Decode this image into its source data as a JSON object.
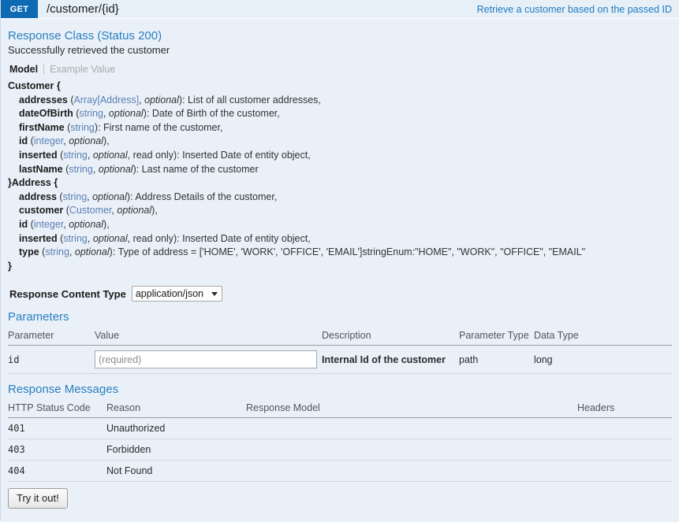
{
  "operation": {
    "method": "GET",
    "path": "/customer/{id}",
    "summary": "Retrieve a customer based on the passed ID"
  },
  "response_class": {
    "title": "Response Class (Status 200)",
    "description": "Successfully retrieved the customer",
    "tabs": {
      "model": "Model",
      "example_value": "Example Value"
    }
  },
  "model": {
    "customer_open": "Customer {",
    "customer_props": [
      {
        "name": "addresses",
        "types": "(Array[Address], optional)",
        "type_text": "Array[Address]",
        "optional": "optional",
        "description": ": List of all customer addresses,"
      },
      {
        "name": "dateOfBirth",
        "type_text": "string",
        "optional": "optional",
        "description": ": Date of Birth of the customer,"
      },
      {
        "name": "firstName",
        "type_text": "string",
        "optional": "",
        "description": ": First name of the customer,"
      },
      {
        "name": "id",
        "type_text": "integer",
        "optional": "optional",
        "description": ","
      },
      {
        "name": "inserted",
        "type_text": "string",
        "optional": "optional",
        "readonly": "read only",
        "description": ": Inserted Date of entity object,"
      },
      {
        "name": "lastName",
        "type_text": "string",
        "optional": "optional",
        "description": ": Last name of the customer"
      }
    ],
    "address_open": "}Address {",
    "address_props": [
      {
        "name": "address",
        "type_text": "string",
        "optional": "optional",
        "description": ": Address Details of the customer,"
      },
      {
        "name": "customer",
        "type_text": "Customer",
        "optional": "optional",
        "description": ","
      },
      {
        "name": "id",
        "type_text": "integer",
        "optional": "optional",
        "description": ","
      },
      {
        "name": "inserted",
        "type_text": "string",
        "optional": "optional",
        "readonly": "read only",
        "description": ": Inserted Date of entity object,"
      },
      {
        "name": "type",
        "type_text": "string",
        "optional": "optional",
        "description": ": Type of address = ['HOME', 'WORK', 'OFFICE', 'EMAIL']stringEnum:\"HOME\", \"WORK\", \"OFFICE\", \"EMAIL\""
      }
    ],
    "close": "}"
  },
  "content_type": {
    "label": "Response Content Type",
    "selected": "application/json",
    "options": [
      "application/json"
    ]
  },
  "parameters": {
    "title": "Parameters",
    "headers": [
      "Parameter",
      "Value",
      "Description",
      "Parameter Type",
      "Data Type"
    ],
    "rows": [
      {
        "parameter": "id",
        "value": "",
        "value_placeholder": "(required)",
        "description": "Internal Id of the customer",
        "parameter_type": "path",
        "data_type": "long"
      }
    ]
  },
  "response_messages": {
    "title": "Response Messages",
    "headers": [
      "HTTP Status Code",
      "Reason",
      "Response Model",
      "Headers"
    ],
    "rows": [
      {
        "code": "401",
        "reason": "Unauthorized",
        "model": "",
        "headers": ""
      },
      {
        "code": "403",
        "reason": "Forbidden",
        "model": "",
        "headers": ""
      },
      {
        "code": "404",
        "reason": "Not Found",
        "model": "",
        "headers": ""
      }
    ]
  },
  "actions": {
    "try_it_out": "Try it out!"
  },
  "colors": {
    "method_get": "#0f6ab4",
    "panel_bg": "#e9f0f8",
    "heading_link": "#2a7fc0",
    "type_link": "#5b7fb5"
  }
}
